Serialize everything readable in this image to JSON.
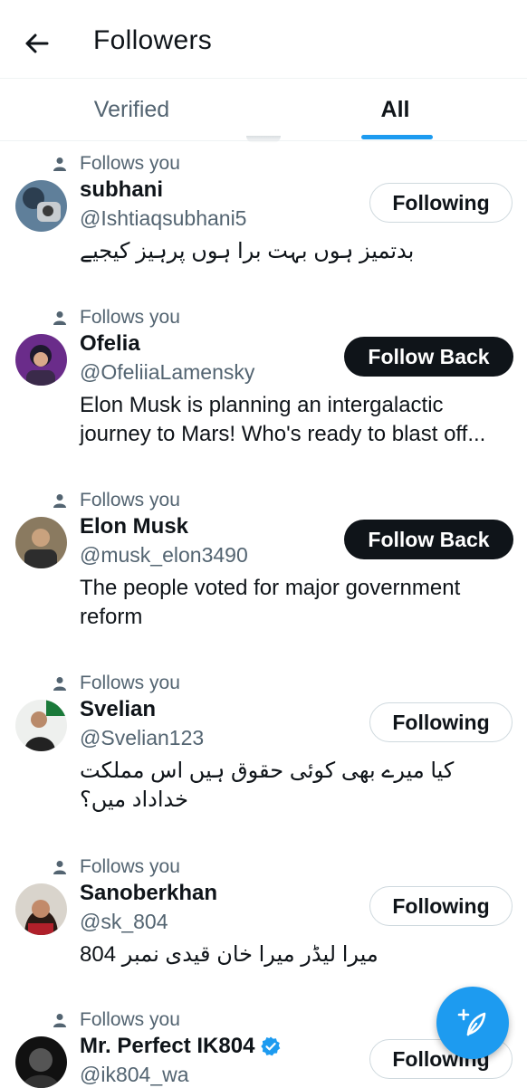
{
  "header": {
    "title": "Followers",
    "back_icon": "arrow-left-icon"
  },
  "tabs": [
    {
      "label": "Verified",
      "active": false
    },
    {
      "label": "All",
      "active": true
    }
  ],
  "accent_color": "#1d9bf0",
  "follows_you_label": "Follows you",
  "users": [
    {
      "name": "subhani",
      "handle": "@Ishtiaqsubhani5",
      "bio": "بدتمیز ہوں بہت برا ہوں پرہیز کیجیے",
      "button": "Following",
      "verified": false
    },
    {
      "name": "Ofelia",
      "handle": "@OfeliiaLamensky",
      "bio": "Elon Musk is planning an intergalactic journey to Mars! Who's ready to blast off...",
      "button": "Follow Back",
      "verified": false
    },
    {
      "name": "Elon Musk",
      "handle": "@musk_elon3490",
      "bio": "The people voted for major government reform",
      "button": "Follow Back",
      "verified": false
    },
    {
      "name": "Svelian",
      "handle": "@Svelian123",
      "bio": "کیا میرے بھی کوئی حقوق ہیں اس مملکت خداداد میں؟",
      "button": "Following",
      "verified": false
    },
    {
      "name": "Sanoberkhan",
      "handle": "@sk_804",
      "bio": "میرا لیڈر میرا خان قیدی نمبر 804",
      "button": "Following",
      "verified": false
    },
    {
      "name": "Mr. Perfect IK804",
      "handle": "@ik804_wa",
      "bio": "",
      "button": "Following",
      "verified": true
    }
  ],
  "fab": {
    "icon": "compose-feather-icon"
  }
}
